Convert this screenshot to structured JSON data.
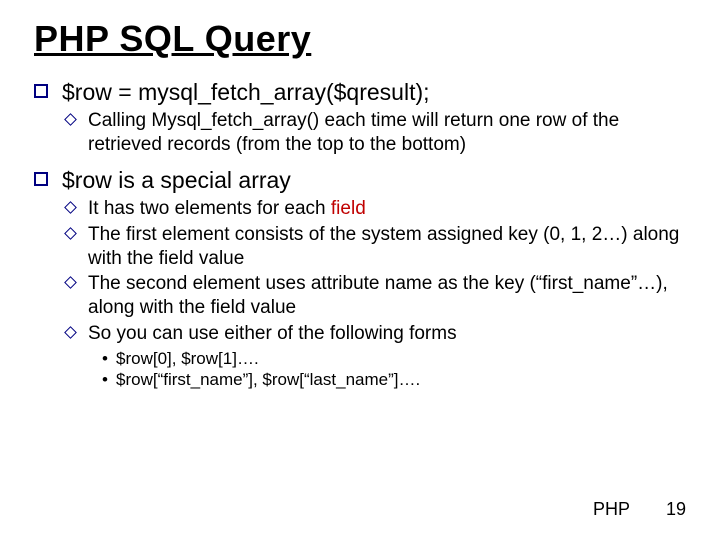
{
  "title": "PHP SQL Query",
  "bullet1": {
    "text": "$row = mysql_fetch_array($qresult);",
    "sub1": "Calling Mysql_fetch_array() each time will return one row of the retrieved records (from the top to the bottom)"
  },
  "bullet2": {
    "text": "$row is a special array",
    "sub1_pre": "It has two elements for each ",
    "sub1_hl": "field",
    "sub2": "The first element consists of the system assigned key (0, 1, 2…) along with the field value",
    "sub3": "The second element uses attribute name as the key (“first_name”…), along with the field value",
    "sub4": "So you can use either of the following forms",
    "sub4a": "$row[0], $row[1]….",
    "sub4b": "$row[“first_name”], $row[“last_name”]…."
  },
  "footer": {
    "label": "PHP",
    "page": "19"
  }
}
